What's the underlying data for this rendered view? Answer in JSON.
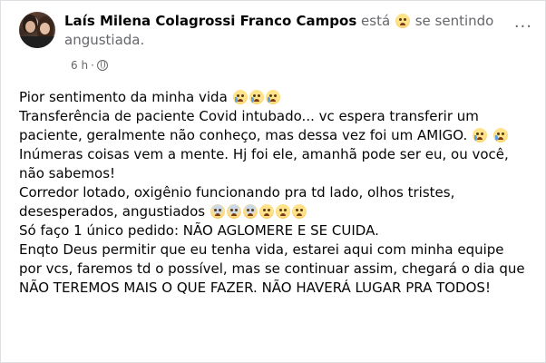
{
  "post": {
    "author": "Laís Milena Colagrossi Franco Campos",
    "status_prefix": "está",
    "status_feeling": "se sentindo angustiada.",
    "time": "6 h",
    "privacy_separator": "·",
    "more_label": "···",
    "feeling_icon": "anguished-face-icon",
    "privacy_icon": "globe-icon"
  },
  "body": {
    "line1": "Pior sentimento da minha vida",
    "line2": "Transferência de paciente Covid intubado... vc espera transferir um paciente, geralmente não conheço, mas dessa vez foi um AMIGO.",
    "line3": "Inúmeras coisas vem a mente. Hj foi ele, amanhã pode ser eu, ou você, não sabemos!",
    "line4": "Corredor lotado, oxigênio funcionando pra td lado, olhos tristes, desesperados, angustiados",
    "line5": "Só faço 1 único pedido: NÃO AGLOMERE E SE CUIDA.",
    "line6": "Enqto Deus permitir que eu tenha vida, estarei aqui com minha equipe por vcs, faremos td o possível, mas se continuar assim, chegará o dia que NÃO TEREMOS MAIS O QUE FAZER. NÃO HAVERÁ LUGAR PRA TODOS!"
  }
}
